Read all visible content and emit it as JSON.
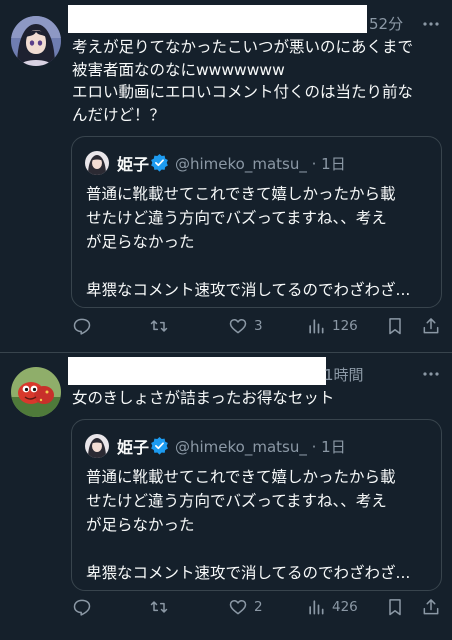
{
  "posts": [
    {
      "time": "52分",
      "lines": [
        "考えが足りてなかったこいつが悪いのにあくまで",
        "被害者面なのなにwwwwwww",
        "エロい動画にエロいコメント付くのは当たり前な",
        "んだけど！？"
      ],
      "quote": {
        "name": "姫子",
        "handle": "@himeko_matsu_ · 1日",
        "lines": [
          "普通に靴載せてこれできて嬉しかったから載",
          "せたけど違う方向でバズってますね、、考え",
          "が足らなかった",
          "",
          "卑猥なコメント速攻で消してるのでわざわざ..."
        ]
      },
      "likes": "3",
      "views": "126"
    },
    {
      "time": "1時間",
      "lines": [
        "女のきしょさが詰まったお得なセット"
      ],
      "quote": {
        "name": "姫子",
        "handle": "@himeko_matsu_ · 1日",
        "lines": [
          "普通に靴載せてこれできて嬉しかったから載",
          "せたけど違う方向でバズってますね、、考え",
          "が足らなかった",
          "",
          "卑猥なコメント速攻で消してるのでわざわざ..."
        ]
      },
      "likes": "2",
      "views": "426"
    }
  ],
  "colors": {
    "background": "#15202b",
    "text": "#f7f9f9",
    "muted": "#8b98a5",
    "border": "#38444d",
    "verified": "#1d9bf0"
  },
  "icons": [
    "more-icon",
    "reply-icon",
    "repost-icon",
    "like-icon",
    "views-icon",
    "bookmark-icon",
    "share-icon",
    "verified-badge-icon"
  ]
}
